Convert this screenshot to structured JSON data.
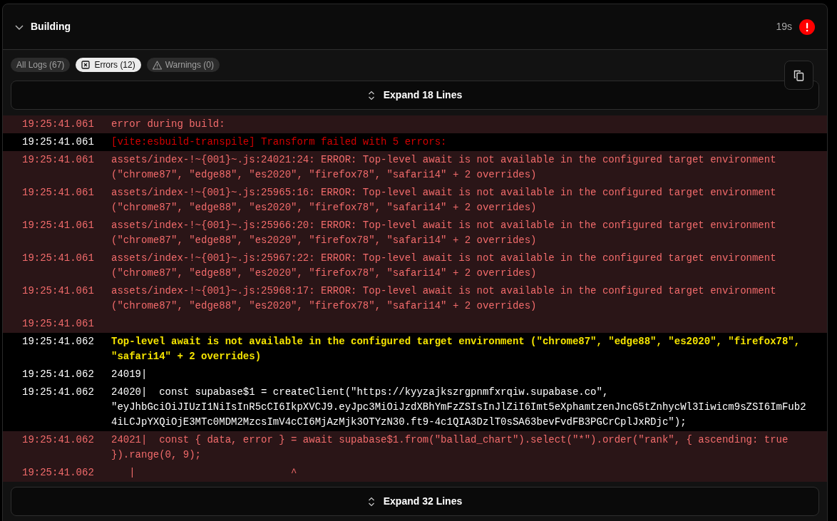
{
  "section": {
    "title": "Building",
    "expanded": true,
    "duration": "19s",
    "failed": true
  },
  "filters": [
    {
      "kind": "all",
      "label": "All Logs (67)",
      "selected": false
    },
    {
      "kind": "errors",
      "label": "Errors (12)",
      "selected": true
    },
    {
      "kind": "warnings",
      "label": "Warnings (0)",
      "selected": false
    }
  ],
  "expand_top": "Expand 18 Lines",
  "logs": [
    {
      "kind": "error",
      "time": "19:25:41.061",
      "lines": [
        "error during build:"
      ]
    },
    {
      "kind": "stderr",
      "time": "19:25:41.061",
      "lines": [
        "[vite:esbuild-transpile] Transform failed with 5 errors:"
      ]
    },
    {
      "kind": "error",
      "time": "19:25:41.061",
      "lines": [
        "assets/index-!~{001}~.js:24021:24: ERROR: Top-level await is not available in the configured target environment",
        "(\"chrome87\", \"edge88\", \"es2020\", \"firefox78\", \"safari14\" + 2 overrides)"
      ]
    },
    {
      "kind": "error",
      "time": "19:25:41.061",
      "lines": [
        "assets/index-!~{001}~.js:25965:16: ERROR: Top-level await is not available in the configured target environment",
        "(\"chrome87\", \"edge88\", \"es2020\", \"firefox78\", \"safari14\" + 2 overrides)"
      ]
    },
    {
      "kind": "error",
      "time": "19:25:41.061",
      "lines": [
        "assets/index-!~{001}~.js:25966:20: ERROR: Top-level await is not available in the configured target environment",
        "(\"chrome87\", \"edge88\", \"es2020\", \"firefox78\", \"safari14\" + 2 overrides)"
      ]
    },
    {
      "kind": "error",
      "time": "19:25:41.061",
      "lines": [
        "assets/index-!~{001}~.js:25967:22: ERROR: Top-level await is not available in the configured target environment",
        "(\"chrome87\", \"edge88\", \"es2020\", \"firefox78\", \"safari14\" + 2 overrides)"
      ]
    },
    {
      "kind": "error",
      "time": "19:25:41.061",
      "lines": [
        "assets/index-!~{001}~.js:25968:17: ERROR: Top-level await is not available in the configured target environment",
        "(\"chrome87\", \"edge88\", \"es2020\", \"firefox78\", \"safari14\" + 2 overrides)"
      ]
    },
    {
      "kind": "error",
      "time": "19:25:41.061"
    },
    {
      "kind": "warning",
      "time": "19:25:41.062",
      "lines": [
        "Top-level await is not available in the configured target environment (\"chrome87\", \"edge88\", \"es2020\", \"firefox78\",",
        "\"safari14\" + 2 overrides)"
      ]
    },
    {
      "kind": "plain",
      "time": "19:25:41.062",
      "lines": [
        "24019|"
      ]
    },
    {
      "kind": "plain",
      "time": "19:25:41.062",
      "lines": [
        "24020|  const supabase$1 = createClient(\"https://kyyzajkszrgpnmfxrqiw.supabase.co\",",
        "\"eyJhbGciOiJIUzI1NiIsInR5cCI6IkpXVCJ9.eyJpc3MiOiJzdXBhYmFzZSIsInJlZiI6Imt5eXphamtzenJncG5tZnhycWl3Iiwicm9sZSI6ImFub2",
        "4iLCJpYXQiOjE3MTc0MDM2MzcsImV4cCI6MjAzMjk3OTYzN30.ft9-4c1QIA3DzlT0sSA63bevFvdFB3PGCrCplJxRDjc\");"
      ]
    },
    {
      "kind": "error",
      "time": "19:25:41.062",
      "lines": [
        "24021|  const { data, error } = await supabase$1.from(\"ballad_chart\").select(\"*\").order(\"rank\", { ascending: true",
        "}).range(0, 9);"
      ]
    },
    {
      "kind": "error",
      "time": "19:25:41.062",
      "lines": [
        "   |                          ^"
      ]
    }
  ],
  "expand_bottom": "Expand 32 Lines"
}
